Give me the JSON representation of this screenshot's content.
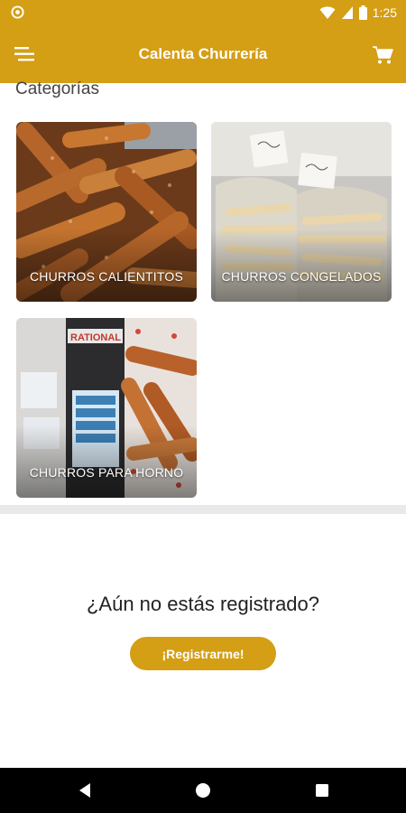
{
  "status_bar": {
    "time": "1:25",
    "icons": [
      "notification-circle-icon",
      "wifi-icon",
      "signal-icon",
      "battery-icon"
    ]
  },
  "app_bar": {
    "title": "Calenta Churrería",
    "menu_icon": "hamburger-menu-icon",
    "cart_icon": "shopping-cart-icon",
    "color": "#d49e15"
  },
  "categories": {
    "heading": "Categorías",
    "items": [
      {
        "label": "CHURROS CALIENTITOS"
      },
      {
        "label": "CHURROS CONGELADOS"
      },
      {
        "label": "CHURROS PARA HORNO"
      }
    ]
  },
  "register": {
    "question": "¿Aún no estás registrado?",
    "button_label": "¡Registrarme!"
  },
  "nav_bar": {
    "icons": [
      "back-icon",
      "home-icon",
      "recents-icon"
    ]
  }
}
